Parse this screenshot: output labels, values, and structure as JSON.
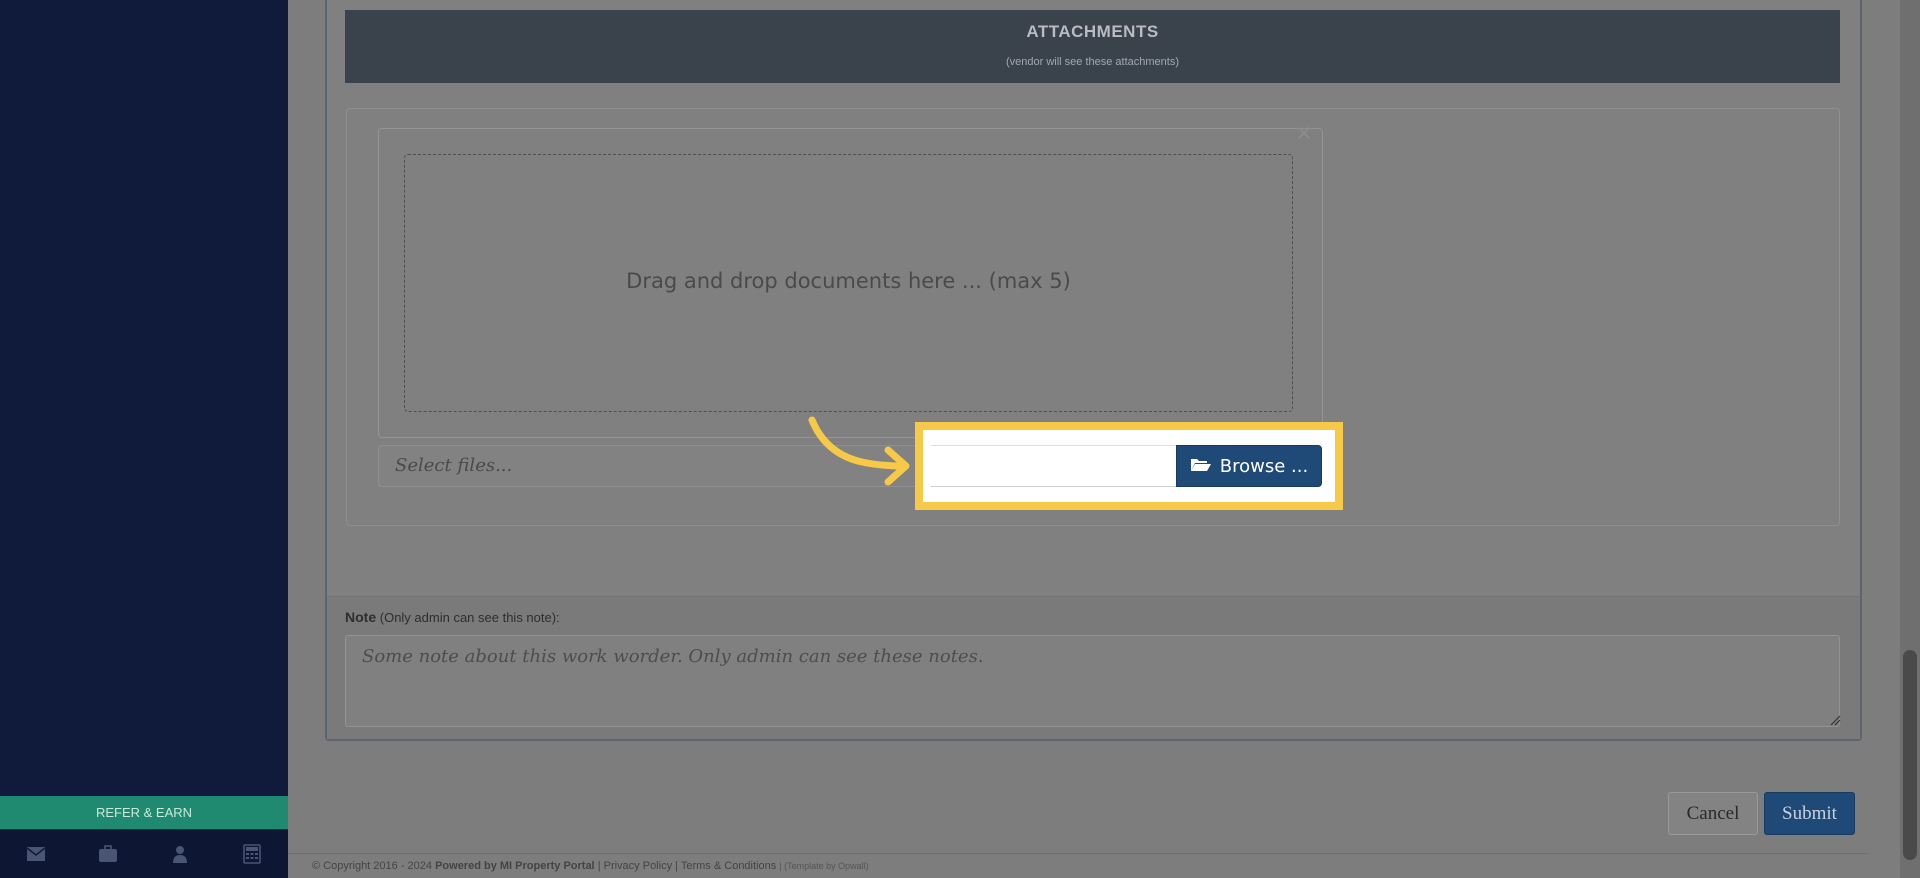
{
  "sidebar": {
    "refer_label": "REFER & EARN",
    "icons": [
      "envelope-icon",
      "briefcase-icon",
      "user-icon",
      "calculator-icon"
    ]
  },
  "attachments": {
    "title": "ATTACHMENTS",
    "subtitle": "(vendor will see these attachments)",
    "drop_text": "Drag and drop documents here ... (max 5)",
    "close_glyph": "×",
    "file_placeholder": "Select files...",
    "browse_label": "Browse ..."
  },
  "note": {
    "label": "Note",
    "label_hint": "(Only admin can see this note):",
    "placeholder": "Some note about this work worder. Only admin can see these notes."
  },
  "actions": {
    "cancel_label": "Cancel",
    "submit_label": "Submit"
  },
  "footer": {
    "copyright": "© Copyright 2016 - 2024",
    "powered": "Powered by MI Property Portal",
    "sep1": "|",
    "privacy": "Privacy Policy",
    "sep2": "|",
    "terms": "Terms & Conditions",
    "template": "| (Template by Opwall)"
  },
  "colors": {
    "highlight": "#f7c948",
    "primary": "#1f4a78",
    "sidebar": "#101a3a",
    "refer": "#1f8a70"
  }
}
